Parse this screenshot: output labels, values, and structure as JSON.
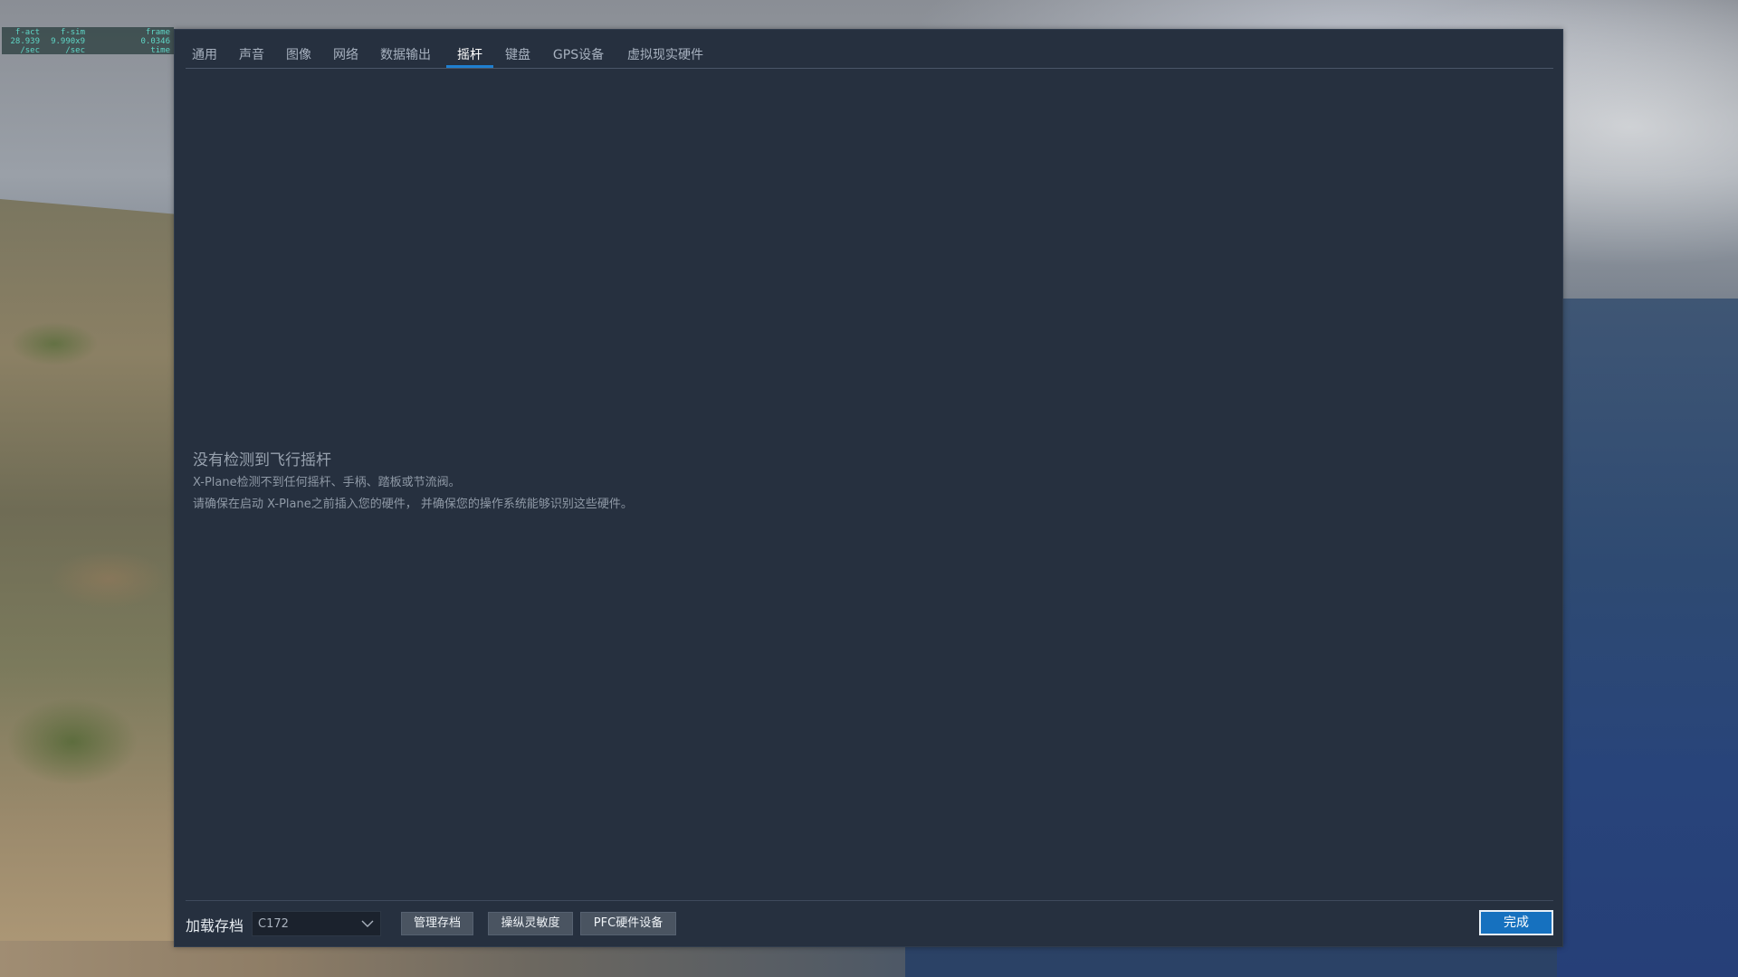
{
  "overlay": {
    "col1": [
      "f-act",
      "28.939",
      "/sec"
    ],
    "col2": [
      "f-sim",
      "9.990x9",
      "/sec"
    ],
    "col3": [
      "frame",
      "0.0346",
      "time"
    ]
  },
  "tabs": [
    {
      "label": "通用",
      "active": false
    },
    {
      "label": "声音",
      "active": false
    },
    {
      "label": "图像",
      "active": false
    },
    {
      "label": "网络",
      "active": false
    },
    {
      "label": "数据输出",
      "active": false
    },
    {
      "label": "摇杆",
      "active": true
    },
    {
      "label": "键盘",
      "active": false
    },
    {
      "label": "GPS设备",
      "active": false
    },
    {
      "label": "虚拟现实硬件",
      "active": false
    }
  ],
  "message": {
    "title": "没有检测到飞行摇杆",
    "line1": "X-Plane检测不到任何摇杆、手柄、踏板或节流阀。",
    "line2": "请确保在启动 X-Plane之前插入您的硬件， 并确保您的操作系统能够识别这些硬件。"
  },
  "footer": {
    "profile_label": "加载存档",
    "profile_value": "C172",
    "manage_button": "管理存档",
    "sensitivity_button": "操纵灵敏度",
    "pfc_button": "PFC硬件设备",
    "done_button": "完成"
  },
  "colors": {
    "accent": "#1f7fd0",
    "dialog_bg": "#26303f",
    "done_bg": "#1671bf"
  }
}
